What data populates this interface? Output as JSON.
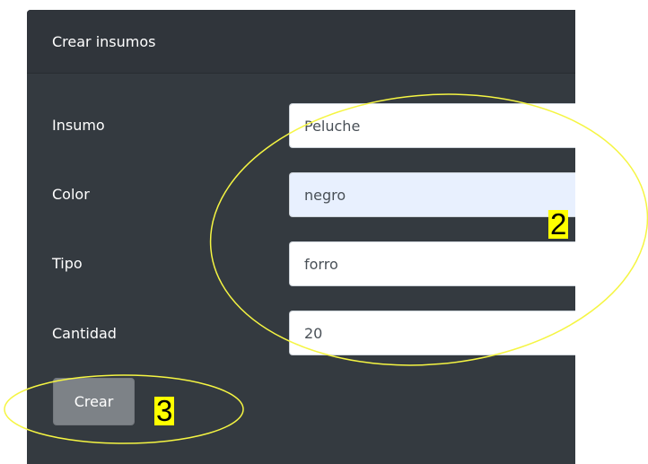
{
  "form": {
    "title": "Crear insumos",
    "fields": [
      {
        "label": "Insumo",
        "value": "Peluche"
      },
      {
        "label": "Color",
        "value": "negro"
      },
      {
        "label": "Tipo",
        "value": "forro"
      },
      {
        "label": "Cantidad",
        "value": "20"
      }
    ],
    "submit_label": "Crear"
  },
  "annotations": {
    "inputs_marker": "2",
    "button_marker": "3",
    "highlight_color": "#ffff00",
    "ellipse_color": "#f5f542"
  },
  "colors": {
    "card_background": "#343a40",
    "button_background": "#7d8287",
    "autofill_background": "#e8f0fe"
  }
}
